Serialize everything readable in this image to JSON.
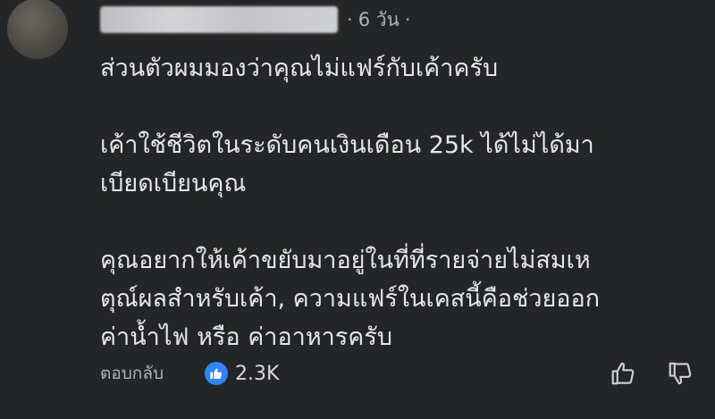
{
  "comment": {
    "author_name": "",
    "time_ago": "6 วัน",
    "separator": "·",
    "paragraphs": [
      "ส่วนตัวผมมองว่าคุณไม่แฟร์กับเค้าครับ",
      "เค้าใช้ชีวิตในระดับคนเงินเดือน 25k ได้ไม่ได้มา\nเบียดเบียนคุณ",
      "คุณอยากให้เค้าขยับมาอยู่ในที่ที่รายจ่ายไม่สมเห\nตุณ์ผลสำหรับเค้า,  ความแฟร์ในเคสนี้คือช่วยออก\nค่าน้ำไฟ หรือ ค่าอาหารครับ"
    ]
  },
  "actions": {
    "reply_label": "ตอบกลับ",
    "reaction_count": "2.3K",
    "reaction_icon": "like-icon",
    "upvote_icon": "thumbs-up-outline-icon",
    "downvote_icon": "thumbs-down-outline-icon"
  },
  "colors": {
    "background": "#242526",
    "primary_text": "#e4e6eb",
    "secondary_text": "#b0b3b8",
    "like_blue": "#2d86ff"
  }
}
